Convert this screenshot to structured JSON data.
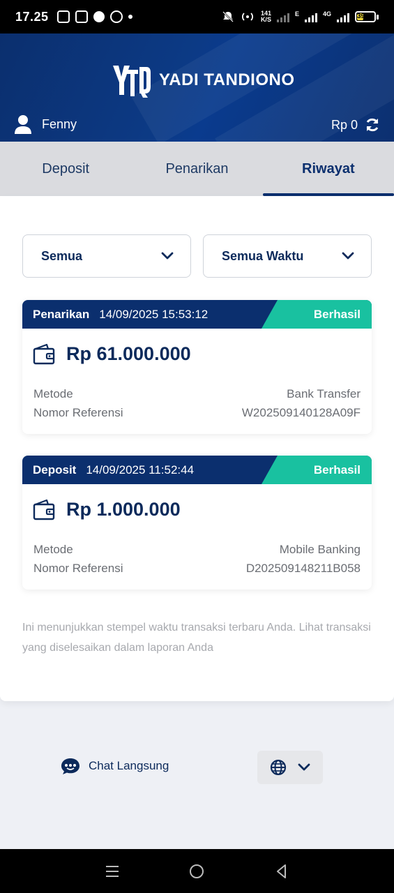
{
  "status_bar": {
    "time": "17.25",
    "net_speed": "141",
    "net_unit": "K/S",
    "network_e": "E",
    "network_4g": "4G",
    "battery": "39"
  },
  "header": {
    "logo_text": "YADI TANDIONO",
    "user_name": "Fenny",
    "balance": "Rp 0"
  },
  "tabs": [
    {
      "label": "Deposit",
      "active": false
    },
    {
      "label": "Penarikan",
      "active": false
    },
    {
      "label": "Riwayat",
      "active": true
    }
  ],
  "filters": {
    "type": "Semua",
    "period": "Semua Waktu"
  },
  "transactions": [
    {
      "type": "Penarikan",
      "datetime": "14/09/2025 15:53:12",
      "status": "Berhasil",
      "amount": "Rp 61.000.000",
      "method_label": "Metode",
      "method": "Bank Transfer",
      "ref_label": "Nomor Referensi",
      "ref": "W202509140128A09F"
    },
    {
      "type": "Deposit",
      "datetime": "14/09/2025 11:52:44",
      "status": "Berhasil",
      "amount": "Rp 1.000.000",
      "method_label": "Metode",
      "method": "Mobile Banking",
      "ref_label": "Nomor Referensi",
      "ref": "D202509148211B058"
    }
  ],
  "note": "Ini menunjukkan stempel waktu transaksi terbaru Anda. Lihat transaksi yang diselesaikan dalam laporan Anda",
  "footer": {
    "chat_label": "Chat Langsung"
  },
  "colors": {
    "primary": "#0b2f6e",
    "success": "#19c1a0",
    "tab_bg": "#dadbdf"
  },
  "icons": [
    "user-icon",
    "refresh-icon",
    "chevron-down-icon",
    "wallet-icon",
    "chat-icon",
    "globe-icon",
    "menu-icon",
    "home-icon",
    "back-icon"
  ]
}
